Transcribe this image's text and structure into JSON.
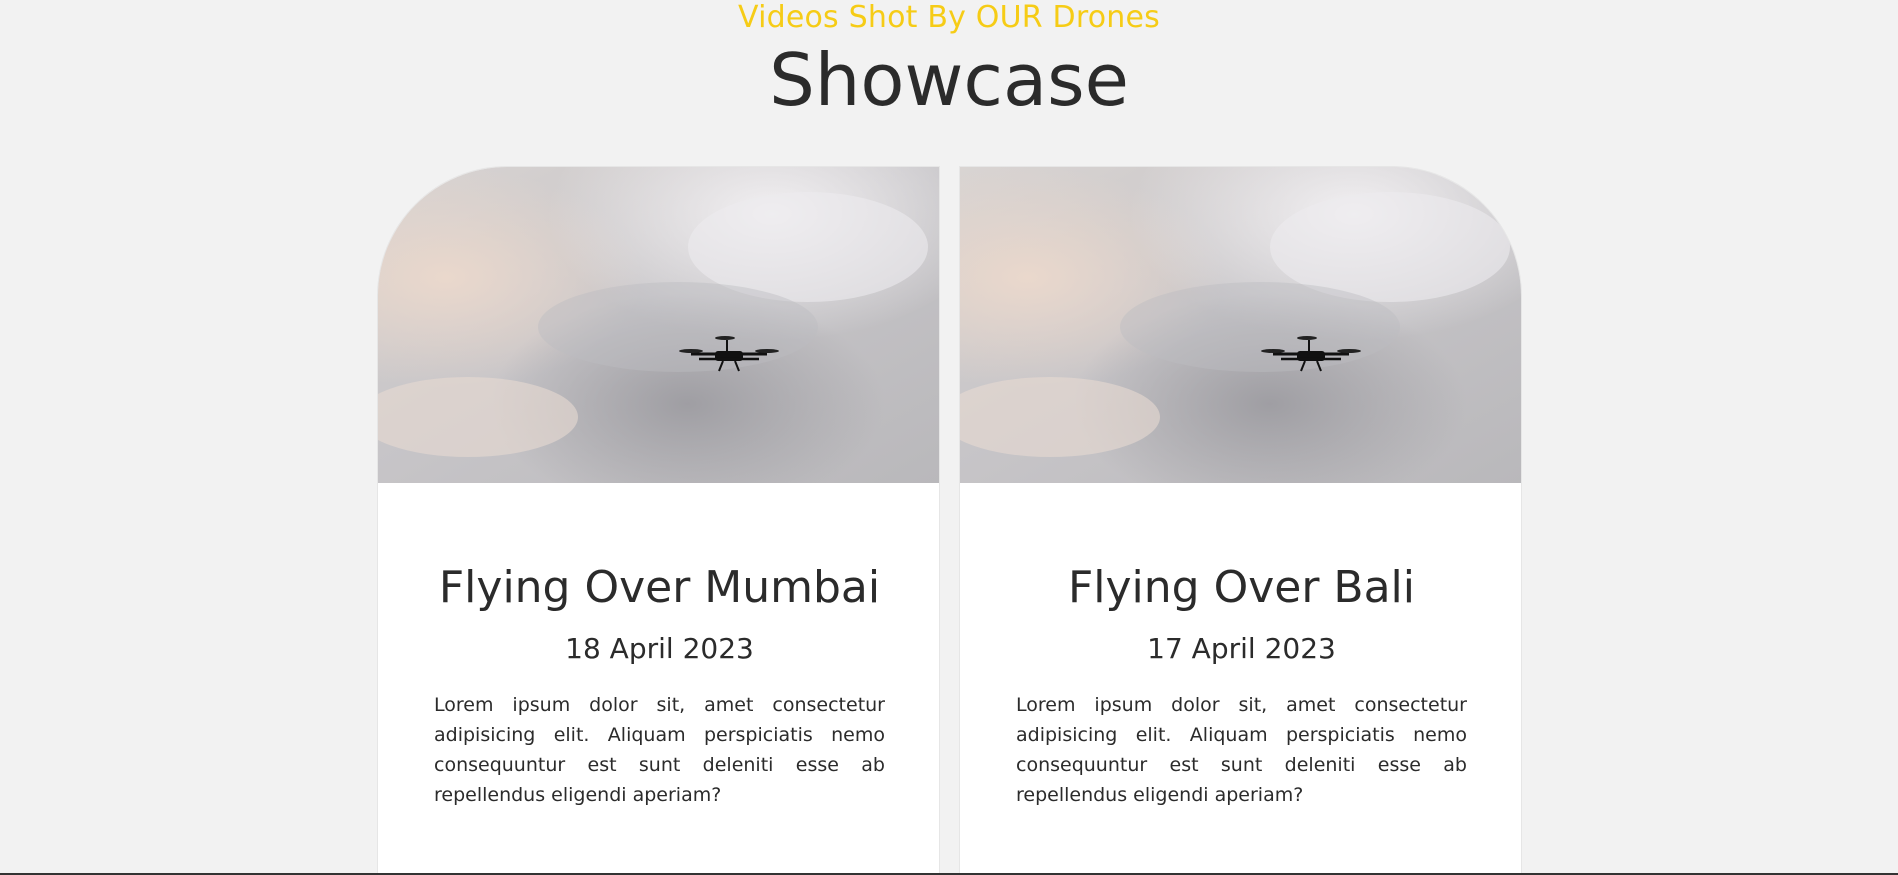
{
  "section": {
    "eyebrow": "Videos Shot By OUR Drones",
    "title": "Showcase"
  },
  "cards": [
    {
      "media_icon": "drone-video-thumbnail",
      "title": "Flying Over Mumbai",
      "date": "18 April 2023",
      "text": "Lorem ipsum dolor sit, amet consectetur adipisicing elit. Aliquam perspiciatis nemo consequuntur est sunt deleniti esse ab repellendus eligendi aperiam?"
    },
    {
      "media_icon": "drone-video-thumbnail",
      "title": "Flying Over Bali",
      "date": "17 April 2023",
      "text": "Lorem ipsum dolor sit, amet consectetur adipisicing elit. Aliquam perspiciatis nemo consequuntur est sunt deleniti esse ab repellendus eligendi aperiam?"
    }
  ],
  "colors": {
    "accent": "#f6cc16",
    "background": "#f2f2f2",
    "card": "#ffffff",
    "text": "#2b2b2b"
  }
}
